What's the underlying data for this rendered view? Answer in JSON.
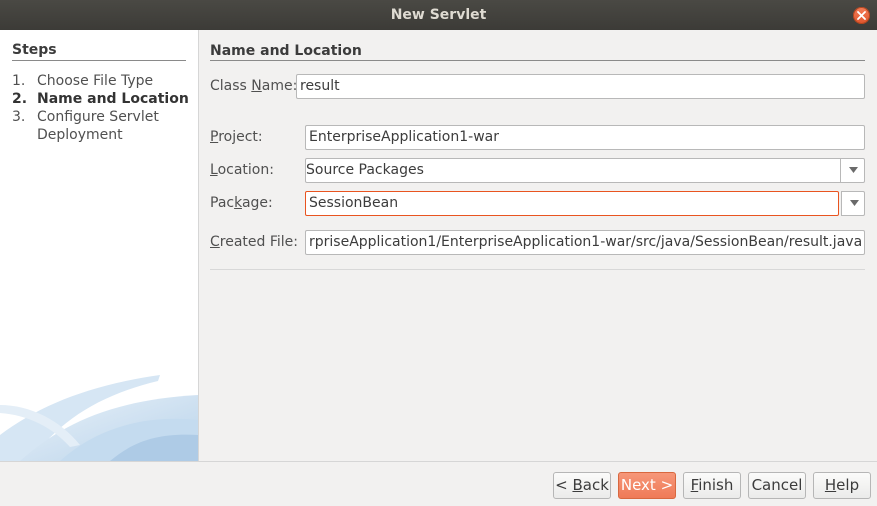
{
  "window": {
    "title": "New Servlet"
  },
  "steps": {
    "heading": "Steps",
    "items": [
      {
        "num": "1.",
        "label": "Choose File Type"
      },
      {
        "num": "2.",
        "label": "Name and Location"
      },
      {
        "num": "3.",
        "label": "Configure Servlet"
      },
      {
        "num": "",
        "label": "Deployment"
      }
    ]
  },
  "form": {
    "heading": "Name and Location",
    "class_name": {
      "label_pre": "Class ",
      "label_mnemonic": "N",
      "label_post": "ame:",
      "value": "result"
    },
    "project": {
      "label_pre": "",
      "label_mnemonic": "P",
      "label_post": "roject:",
      "value": "EnterpriseApplication1-war"
    },
    "location": {
      "label_pre": "",
      "label_mnemonic": "L",
      "label_post": "ocation:",
      "value": "Source Packages"
    },
    "package": {
      "label_pre": "Pac",
      "label_mnemonic": "k",
      "label_post": "age:",
      "value": "SessionBean"
    },
    "created_file": {
      "label_pre": "",
      "label_mnemonic": "C",
      "label_post": "reated File:",
      "value": "rpriseApplication1/EnterpriseApplication1-war/src/java/SessionBean/result.java"
    }
  },
  "buttons": {
    "back": {
      "pre": "< ",
      "mn": "B",
      "post": "ack"
    },
    "next": {
      "pre": "Next >",
      "mn": "",
      "post": ""
    },
    "finish": {
      "pre": "",
      "mn": "F",
      "post": "inish"
    },
    "cancel": {
      "pre": "Cancel",
      "mn": "",
      "post": ""
    },
    "help": {
      "pre": "",
      "mn": "H",
      "post": "elp"
    }
  },
  "colors": {
    "accent": "#e95420",
    "primary_button": "#f08a6a",
    "titlebar": "#3c3b37"
  },
  "icons": {
    "close": "close-icon",
    "dropdown": "chevron-down-icon"
  }
}
